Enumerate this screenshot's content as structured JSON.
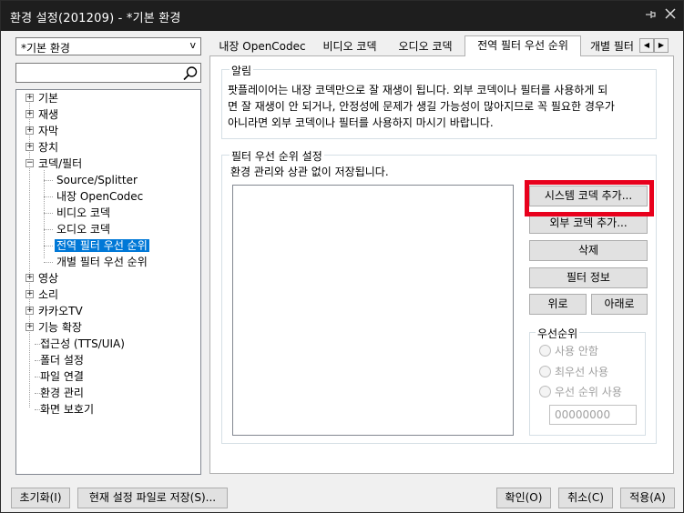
{
  "window": {
    "title": "환경 설정(201209) - *기본 환경",
    "pin_icon": "pin-icon",
    "close_icon": "close-icon"
  },
  "profile_combo": {
    "value": "*기본 환경",
    "arrow": "v"
  },
  "search": {
    "value": "",
    "icon": "search-icon"
  },
  "tree": {
    "items": [
      {
        "label": "기본",
        "expander": "+"
      },
      {
        "label": "재생",
        "expander": "+"
      },
      {
        "label": "자막",
        "expander": "+"
      },
      {
        "label": "장치",
        "expander": "+"
      },
      {
        "label": "코덱/필터",
        "expander": "−"
      },
      {
        "label": "Source/Splitter"
      },
      {
        "label": "내장 OpenCodec"
      },
      {
        "label": "비디오 코덱"
      },
      {
        "label": "오디오 코덱"
      },
      {
        "label": "전역 필터 우선 순위",
        "selected": true
      },
      {
        "label": "개별 필터 우선 순위"
      },
      {
        "label": "영상",
        "expander": "+"
      },
      {
        "label": "소리",
        "expander": "+"
      },
      {
        "label": "카카오TV",
        "expander": "+"
      },
      {
        "label": "기능 확장",
        "expander": "+"
      },
      {
        "label": "접근성 (TTS/UIA)"
      },
      {
        "label": "폴더 설정"
      },
      {
        "label": "파일 연결"
      },
      {
        "label": "환경 관리"
      },
      {
        "label": "화면 보호기"
      }
    ]
  },
  "tabs": [
    {
      "label": "내장 OpenCodec"
    },
    {
      "label": "비디오 코덱"
    },
    {
      "label": "오디오 코덱"
    },
    {
      "label": "전역 필터 우선 순위",
      "active": true
    },
    {
      "label": "개별 필터"
    }
  ],
  "tab_scroll": {
    "left": "◀",
    "right": "▶"
  },
  "notice": {
    "title": "알림",
    "lines": [
      "팟플레이어는 내장 코덱만으로 잘 재생이 됩니다. 외부 코덱이나 필터를 사용하게 되",
      "면 잘 재생이 안 되거나, 안정성에 문제가 생길 가능성이 많아지므로 꼭 필요한 경우가",
      "아니라면 외부 코덱이나 필터를 사용하지 마시기 바랍니다."
    ]
  },
  "filter_priority": {
    "title": "필터 우선 순위 설정",
    "description": "환경 관리와 상관 없이 저장됩니다.",
    "buttons": {
      "add_system_codec": "시스템 코덱 추가...",
      "add_external_codec": "외부 코덱 추가...",
      "delete": "삭제",
      "filter_info": "필터 정보",
      "up": "위로",
      "down": "아래로"
    },
    "priority_group": {
      "title": "우선순위",
      "options": [
        "사용 안함",
        "최우선 사용",
        "우선 순위 사용"
      ],
      "value": "00000000"
    }
  },
  "footer": {
    "reset": "초기화(I)",
    "save_to_file": "현재 설정 파일로 저장(S)...",
    "ok": "확인(O)",
    "cancel": "취소(C)",
    "apply": "적용(A)"
  },
  "colors": {
    "titlebar": "#1e1e1e",
    "selection": "#0078d7",
    "highlight_box": "#e8001c"
  }
}
